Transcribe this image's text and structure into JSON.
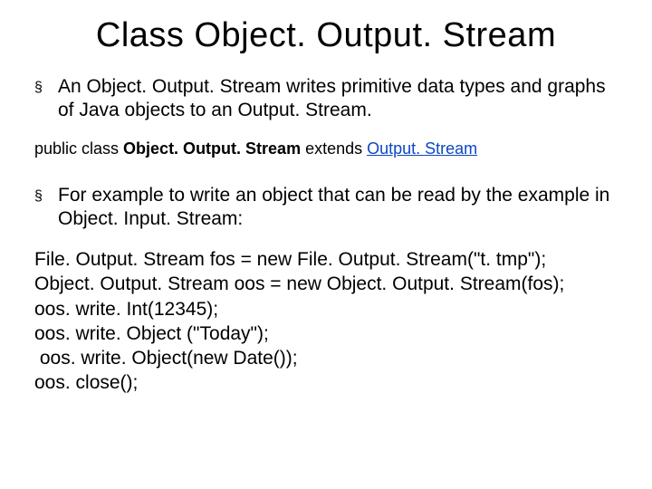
{
  "title": "Class Object. Output. Stream",
  "bullet1": "An Object. Output. Stream writes primitive data types and graphs of Java objects to an Output. Stream.",
  "decl": {
    "prefix": "public class ",
    "classname": "Object. Output. Stream",
    "extends": "  extends  ",
    "parent": "Output. Stream"
  },
  "bullet2": "For example to write an object that can be read by the example in Object. Input. Stream:",
  "code": {
    "l1": "File. Output. Stream fos = new File. Output. Stream(\"t. tmp\");",
    "l2": "Object. Output. Stream oos = new Object. Output. Stream(fos);",
    "l3": "oos. write. Int(12345);",
    "l4": "oos. write. Object (\"Today\");",
    "l5": " oos. write. Object(new Date());",
    "l6": "oos. close();"
  },
  "markers": {
    "square": "§"
  }
}
